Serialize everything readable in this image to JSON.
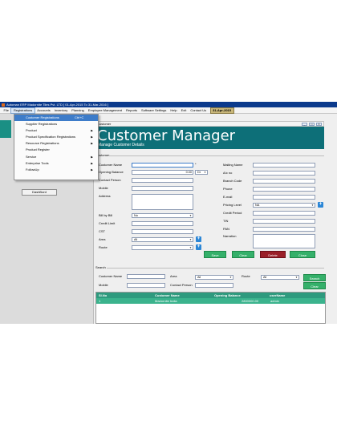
{
  "titlebar": {
    "text": "Automan ERP Madornite Tiles Pvt. LTD [ 01-Apr-2015 To 31-Mar-2016 ]"
  },
  "menubar": {
    "items": [
      "File",
      "Registrations",
      "Accounts",
      "Inventory",
      "Planning",
      "Employee Management",
      "Reports",
      "Software Settings",
      "Help",
      "Exit",
      "Contact Us"
    ],
    "date": "31-Apr-2015"
  },
  "dropdown": {
    "items": [
      {
        "label": "Customer Registrations",
        "shortcut": "Ctrl+C",
        "submenu": false
      },
      {
        "label": "Supplier Registrations",
        "shortcut": "",
        "submenu": false
      },
      {
        "label": "Product",
        "shortcut": "",
        "submenu": true
      },
      {
        "label": "Product Specification Registrations",
        "shortcut": "",
        "submenu": true
      },
      {
        "label": "Resource Registrations",
        "shortcut": "",
        "submenu": true
      },
      {
        "label": "Product Register",
        "shortcut": "",
        "submenu": false
      },
      {
        "label": "Service",
        "shortcut": "",
        "submenu": true
      },
      {
        "label": "Enterprise Tools",
        "shortcut": "",
        "submenu": true
      },
      {
        "label": "FollowUp",
        "shortcut": "",
        "submenu": true
      }
    ]
  },
  "leftpanel": {
    "dashboard_label": "DashBord"
  },
  "window": {
    "title": "Customer",
    "controls": [
      "_",
      "□",
      "✕"
    ]
  },
  "header": {
    "title": "Customer Manager",
    "subtitle": "Manage Customer Details"
  },
  "customer": {
    "section_label": "Customer",
    "left_labels": [
      "Customer Name",
      "Opening Balance",
      "Contact Person",
      "Mobile",
      "Address",
      "Bill by Bill",
      "Credit Limit",
      "CST",
      "Area",
      "Route"
    ],
    "opening_balance": "0.00",
    "dr_cr": "Dr",
    "bill_by_bill": "No",
    "area": "All",
    "route": "",
    "required_mark": "*",
    "right_labels": [
      "Mailing Name",
      "A/c no",
      "Branch Code",
      "Phone",
      "E-mail",
      "Pricing Level",
      "Credit Period",
      "TIN",
      "PAN",
      "Narration"
    ],
    "pricing_level": "NA",
    "buttons": {
      "save": "Save",
      "clear": "Clear",
      "delete": "Delete",
      "close": "Close"
    }
  },
  "search": {
    "section_label": "Search",
    "customer_name_label": "Customer Name",
    "area_label": "Area",
    "area_value": "All",
    "route_label": "Route",
    "route_value": "All",
    "mobile_label": "Mobile",
    "contact_person_label": "Contact Person",
    "search_button": "Search",
    "clear_button": "Clear"
  },
  "grid": {
    "columns": [
      "Sl.No",
      "Customer Name",
      "Opening Balance",
      "userName"
    ],
    "rows": [
      [
        "1",
        "Madornite India",
        "2800000.00",
        "admin"
      ]
    ]
  },
  "colors": {
    "header_bg": "#0d6f78",
    "button_green": "#35b06a",
    "delete_red": "#9a1f28",
    "grid_header": "#2e9a7e",
    "menu_highlight": "#3d7cc9"
  }
}
